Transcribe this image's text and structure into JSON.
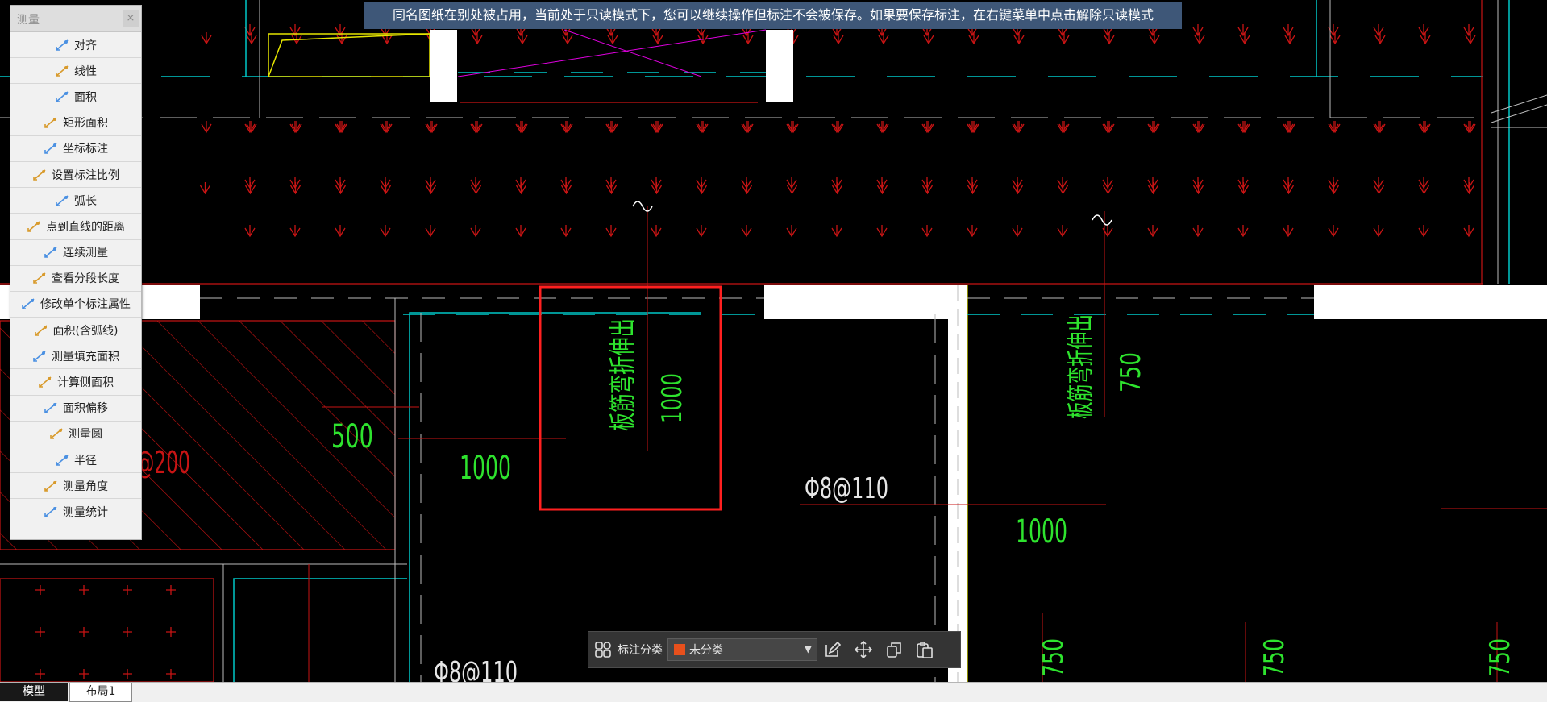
{
  "banner": {
    "text": "同名图纸在别处被占用，当前处于只读模式下，您可以继续操作但标注不会被保存。如果要保存标注，在右键菜单中点击解除只读模式"
  },
  "measure_panel": {
    "title": "测量",
    "close_symbol": "×",
    "tools": [
      {
        "label": "对齐",
        "icon": "align-measure-icon"
      },
      {
        "label": "线性",
        "icon": "linear-measure-icon"
      },
      {
        "label": "面积",
        "icon": "area-icon"
      },
      {
        "label": "矩形面积",
        "icon": "rect-area-icon"
      },
      {
        "label": "坐标标注",
        "icon": "coordinate-icon"
      },
      {
        "label": "设置标注比例",
        "icon": "scale-icon"
      },
      {
        "label": "弧长",
        "icon": "arc-length-icon"
      },
      {
        "label": "点到直线的距离",
        "icon": "point-line-distance-icon"
      },
      {
        "label": "连续测量",
        "icon": "continuous-measure-icon"
      },
      {
        "label": "查看分段长度",
        "icon": "segment-length-icon"
      },
      {
        "label": "修改单个标注属性",
        "icon": "edit-annotation-icon"
      },
      {
        "label": "面积(含弧线)",
        "icon": "arc-area-icon"
      },
      {
        "label": "测量填充面积",
        "icon": "fill-area-icon"
      },
      {
        "label": "计算侧面积",
        "icon": "side-area-icon"
      },
      {
        "label": "面积偏移",
        "icon": "area-offset-icon"
      },
      {
        "label": "测量圆",
        "icon": "circle-icon"
      },
      {
        "label": "半径",
        "icon": "radius-icon"
      },
      {
        "label": "测量角度",
        "icon": "angle-icon"
      },
      {
        "label": "测量统计",
        "icon": "statistics-icon"
      }
    ]
  },
  "drawing": {
    "labels": {
      "rebar_a": "板筋弯折伸出",
      "rebar_a_len": "1000",
      "rebar_b": "板筋弯折伸出",
      "rebar_b_len": "750",
      "dim_500": "500",
      "dim_1000_left": "1000",
      "dim_1000_right": "1000",
      "phi_label": "Φ8@110",
      "phi_label_bottom": "Φ8@110",
      "partial_left": "@200",
      "dim_750_a": "750",
      "dim_750_b": "750",
      "dim_750_c": "750"
    },
    "colors": {
      "background": "#000000",
      "wall_fill": "#ffffff",
      "cyan_line": "#00c8c8",
      "red_line": "#c81414",
      "highlight_box": "#ff2020",
      "green_text": "#2ee32e",
      "magenta_line": "#e000e0",
      "yellow_line": "#e6e600"
    }
  },
  "annotation_toolbar": {
    "label": "标注分类",
    "selected_category": "未分类",
    "category_color": "#e8501c",
    "actions": [
      "edit-icon",
      "move-icon",
      "copy-icon",
      "paste-icon"
    ]
  },
  "tabs": [
    {
      "label": "模型",
      "active": true
    },
    {
      "label": "布局1",
      "active": false
    }
  ]
}
